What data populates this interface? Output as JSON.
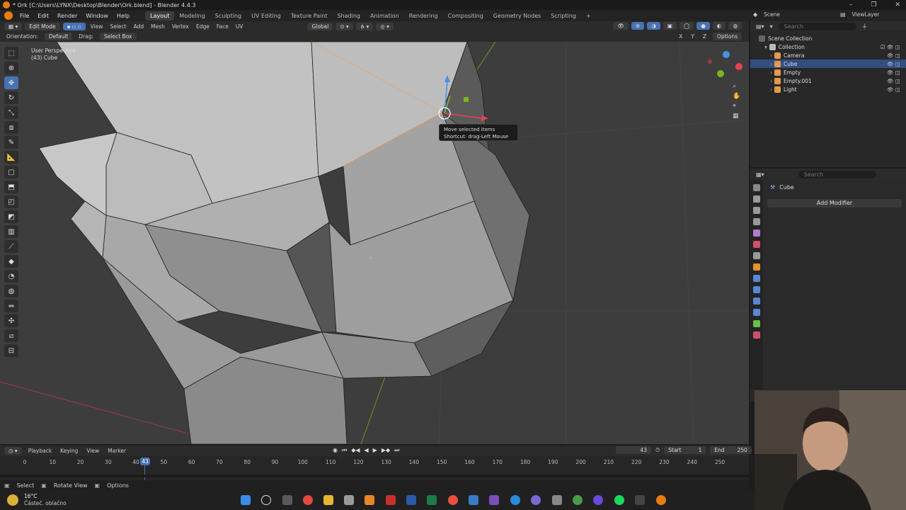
{
  "window": {
    "title": "* Ork [C:\\Users\\LYNX\\Desktop\\Blender\\Ork.blend] - Blender 4.4.3",
    "controls": [
      "–",
      "❐",
      "✕"
    ]
  },
  "menu": [
    "File",
    "Edit",
    "Render",
    "Window",
    "Help"
  ],
  "workspaces": [
    "Layout",
    "Modeling",
    "Sculpting",
    "UV Editing",
    "Texture Paint",
    "Shading",
    "Animation",
    "Rendering",
    "Compositing",
    "Geometry Nodes",
    "Scripting"
  ],
  "active_workspace": "Layout",
  "scene": {
    "label": "Scene",
    "view_layer": "ViewLayer"
  },
  "viewport_header": {
    "mode": "Edit Mode",
    "menus": [
      "View",
      "Select",
      "Add",
      "Mesh",
      "Vertex",
      "Edge",
      "Face",
      "UV"
    ],
    "transform": "Global",
    "orientation_label": "Orientation:",
    "orientation_value": "Default",
    "drag_label": "Drag:",
    "drag_value": "Select Box",
    "options": "Options",
    "axes": [
      "X",
      "Y",
      "Z"
    ]
  },
  "viewport": {
    "perspective": "User Perspective",
    "object_label": "(43) Cube"
  },
  "tooltip": {
    "title": "Move selected items",
    "shortcut": "Shortcut: drag-Left Mouse"
  },
  "outliner": {
    "search_placeholder": "Search",
    "root": "Scene Collection",
    "collection": "Collection",
    "items": [
      {
        "name": "Camera",
        "color": "#e59a4b",
        "selected": false
      },
      {
        "name": "Cube",
        "color": "#e59a4b",
        "selected": true
      },
      {
        "name": "Empty",
        "color": "#e59a4b",
        "selected": false
      },
      {
        "name": "Empty.001",
        "color": "#e59a4b",
        "selected": false
      },
      {
        "name": "Light",
        "color": "#e59a4b",
        "selected": false
      }
    ]
  },
  "properties": {
    "search_placeholder": "Search",
    "object_name": "Cube",
    "add_modifier": "Add Modifier"
  },
  "timeline": {
    "menus": [
      "Playback",
      "Keying",
      "View",
      "Marker"
    ],
    "current_frame": "43",
    "start_label": "Start",
    "start": "1",
    "end_label": "End",
    "end": "250",
    "ticks": [
      "0",
      "10",
      "20",
      "30",
      "40",
      "50",
      "60",
      "70",
      "80",
      "90",
      "100",
      "110",
      "120",
      "130",
      "140",
      "150",
      "160",
      "170",
      "180",
      "190",
      "200",
      "210",
      "220",
      "230",
      "240",
      "250"
    ],
    "playhead": "43"
  },
  "statusbar": {
    "select": "Select",
    "rotate": "Rotate View",
    "options": "Options"
  },
  "taskbar": {
    "temperature": "16°C",
    "weather": "Částeč. oblačno"
  }
}
